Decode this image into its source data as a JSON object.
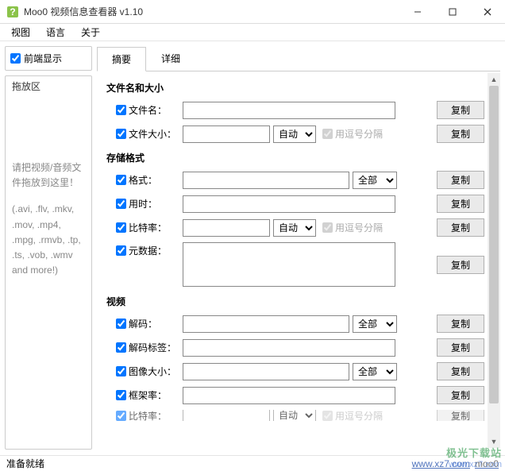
{
  "window": {
    "title": "Moo0 视频信息查看器 v1.10"
  },
  "menu": {
    "view": "视图",
    "language": "语言",
    "about": "关于"
  },
  "left": {
    "front_display": "前端显示",
    "drop_title": "拖放区",
    "drop_hint": "请把视频/音频文件拖放到这里！",
    "drop_ext": "(.avi, .flv, .mkv, .mov, .mp4, .mpg, .rmvb, .tp, .ts, .vob, .wmv and more!)"
  },
  "tabs": {
    "summary": "摘要",
    "detail": "详细"
  },
  "sections": {
    "file": {
      "title": "文件名和大小",
      "filename": "文件名：",
      "filesize": "文件大小："
    },
    "storage": {
      "title": "存储格式",
      "format": "格式：",
      "duration": "用时：",
      "bitrate": "比特率：",
      "metadata": "元数据："
    },
    "video": {
      "title": "视频",
      "decode": "解码：",
      "decode_tag": "解码标签：",
      "image_size": "图像大小：",
      "framerate": "框架率：",
      "bitrate": "比特率："
    }
  },
  "common": {
    "copy": "复制",
    "auto": "自动",
    "all": "全部",
    "comma_sep": "用逗号分隔"
  },
  "status": {
    "ready": "准备就绪",
    "link": "www.xz7.com",
    "moo": "moo0"
  },
  "watermark": {
    "name": "极光下载站",
    "url": "www.xz7.com"
  }
}
